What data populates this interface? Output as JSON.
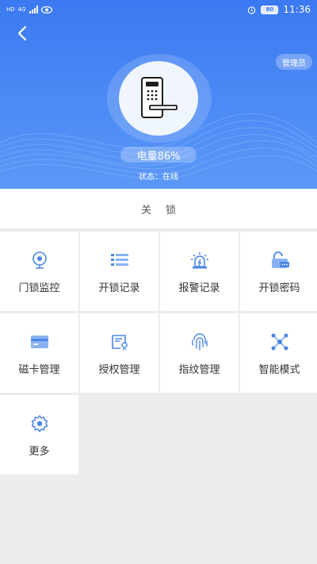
{
  "status_bar": {
    "network_tag": "HD",
    "signal_tag": "4G",
    "battery": "80",
    "time": "11:36"
  },
  "header": {
    "role_badge": "管理员",
    "battery_text": "电量86%",
    "status_text": "状态：在线"
  },
  "lock_action": "关锁",
  "menu": [
    {
      "label": "门锁监控",
      "icon": "camera-icon"
    },
    {
      "label": "开锁记录",
      "icon": "list-icon"
    },
    {
      "label": "报警记录",
      "icon": "alarm-light-icon"
    },
    {
      "label": "开锁密码",
      "icon": "password-lock-icon"
    },
    {
      "label": "磁卡管理",
      "icon": "card-icon"
    },
    {
      "label": "授权管理",
      "icon": "authorization-icon"
    },
    {
      "label": "指纹管理",
      "icon": "fingerprint-icon"
    },
    {
      "label": "智能模式",
      "icon": "smart-mode-icon"
    },
    {
      "label": "更多",
      "icon": "settings-icon"
    }
  ],
  "colors": {
    "header_blue": "#3b79f2",
    "icon_blue": "#4a86e8",
    "background": "#ececec"
  }
}
